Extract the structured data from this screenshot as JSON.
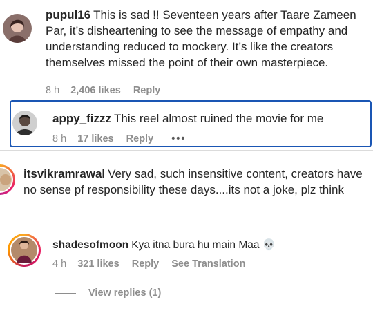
{
  "comments": [
    {
      "username": "pupul16",
      "text": "This is sad !! Seventeen years after Taare Zameen Par, it’s disheartening to see the message of empathy and understanding reduced to mockery. It’s like the creators themselves missed the point of their own masterpiece.",
      "time": "8 h",
      "likes": "2,406 likes",
      "reply_label": "Reply"
    },
    {
      "username": "appy_fizzz",
      "text": "This reel almost ruined the movie for me",
      "time": "8 h",
      "likes": "17 likes",
      "reply_label": "Reply",
      "more_label": "•••"
    },
    {
      "username": "itsvikramrawal",
      "text": "Very sad, such insensitive content, creators have no sense pf responsibility these days....its not a joke, plz think"
    },
    {
      "username": "shadesofmoon",
      "text": "Kya itna bura hu main Maa 💀",
      "time": "4 h",
      "likes": "321 likes",
      "reply_label": "Reply",
      "translation_label": "See Translation"
    }
  ],
  "view_replies": "View replies (1)",
  "colors": {
    "highlight_border": "#1a56b4",
    "meta_text": "#8e8e8e",
    "story_ring_start": "#f9a825",
    "story_ring_end": "#c2185b"
  }
}
